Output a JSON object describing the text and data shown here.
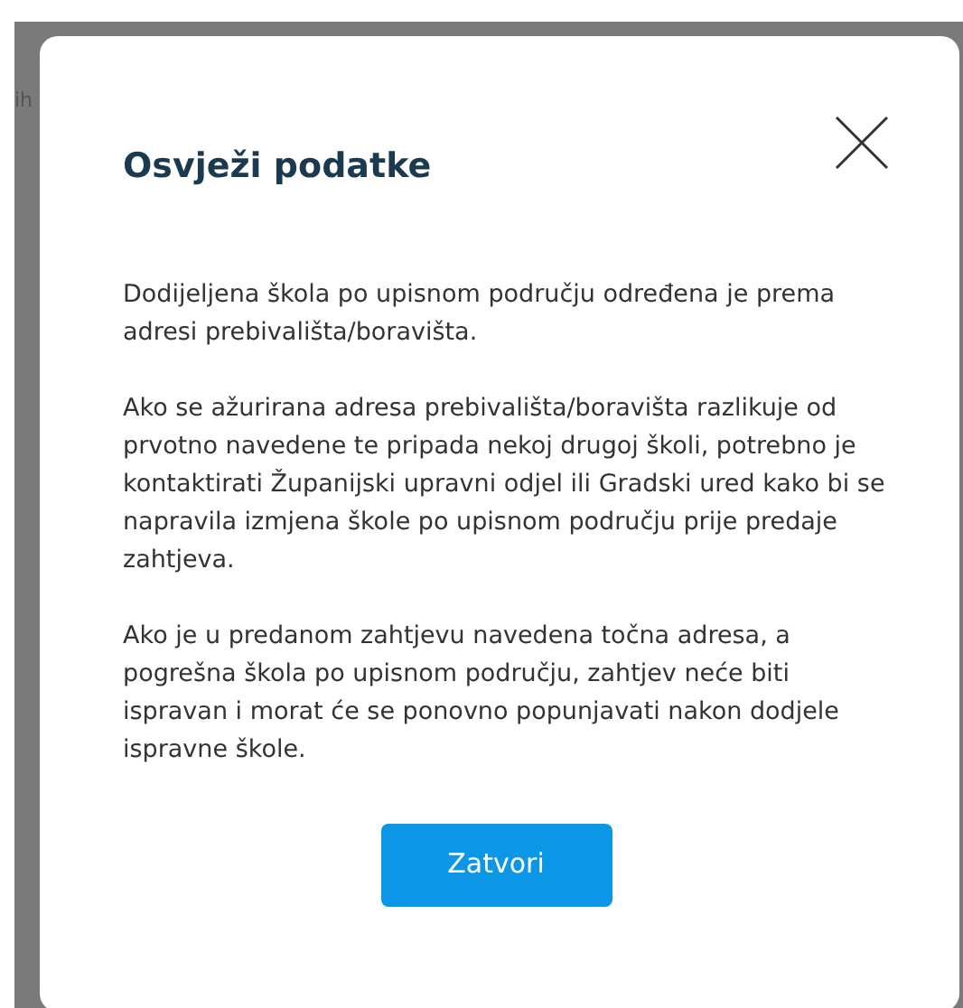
{
  "background": {
    "text": "ih"
  },
  "dialog": {
    "title": "Osvježi podatke",
    "paragraphs": [
      "Dodijeljena škola po upisnom području određena je prema adresi prebivališta/boravišta.",
      "Ako se ažurirana adresa prebivališta/boravišta razlikuje od prvotno navedene te pripada nekoj drugoj školi, potrebno je kontaktirati Županijski upravni odjel ili Gradski ured kako bi se napravila izmjena škole po upisnom području prije predaje zahtjeva.",
      "Ako je u predanom zahtjevu navedena točna adresa, a pogrešna škola po upisnom području, zahtjev neće biti ispravan i morat će se ponovno popunjavati nakon dodjele ispravne škole."
    ],
    "button": "Zatvori"
  }
}
